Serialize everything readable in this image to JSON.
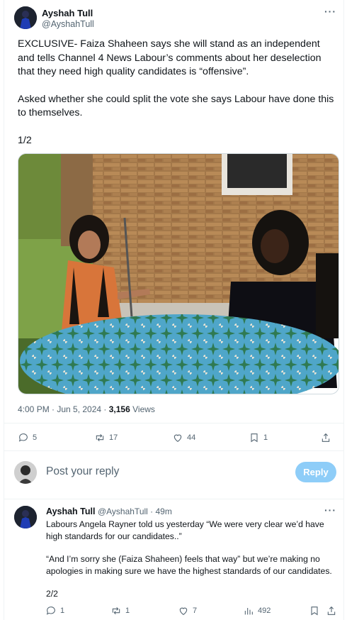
{
  "tweet": {
    "author_name": "Ayshah Tull",
    "author_handle": "@AyshahTull",
    "paragraphs": [
      "EXCLUSIVE- Faiza Shaheen says she will stand as an independent and tells Channel 4 News Labour’s comments about her deselection that they need high quality candidates is “offensive”.",
      "Asked whether she could split the vote she says Labour have done this to themselves.",
      "1/2"
    ],
    "time": "4:00 PM · Jun 5, 2024 · ",
    "views_count": "3,156",
    "views_label": " Views",
    "actions": {
      "replies": "5",
      "reposts": "17",
      "likes": "44",
      "bookmarks": "1"
    }
  },
  "composer": {
    "placeholder": "Post your reply",
    "button_label": "Reply"
  },
  "reply": {
    "author_name": "Ayshah Tull",
    "author_handle": "@AyshahTull · 49m",
    "paragraphs": [
      "Labours Angela Rayner told us yesterday “We were very clear we’d have high standards for our candidates..”",
      "“And I’m sorry she (Faiza Shaheen) feels that way” but we’re making no apologies in making sure we have the highest standards of our candidates.",
      "2/2"
    ],
    "actions": {
      "replies": "1",
      "reposts": "1",
      "likes": "7",
      "views": "492"
    }
  },
  "colors": {
    "accent_disabled": "#8ecdf8",
    "muted": "#536471",
    "text": "#0f1419"
  }
}
